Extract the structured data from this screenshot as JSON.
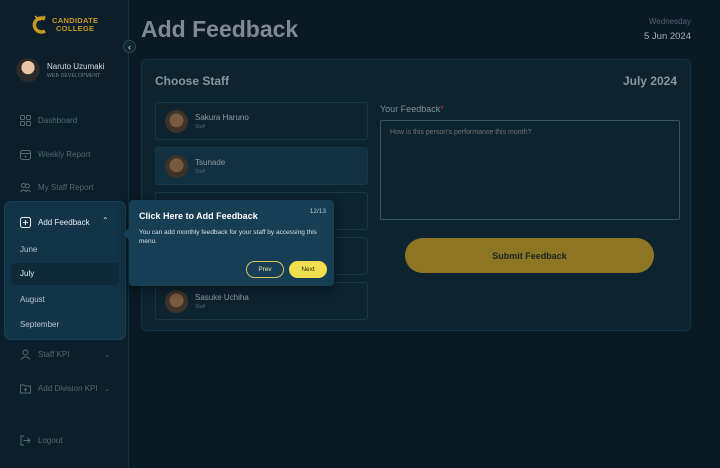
{
  "brand": {
    "name_line1": "CANDIDATE",
    "name_line2": "COLLEGE"
  },
  "profile": {
    "name": "Naruto Uzumaki",
    "role": "WEB DEVELOPMENT"
  },
  "sidebar": {
    "items": [
      {
        "label": "Dashboard",
        "icon": "grid-icon"
      },
      {
        "label": "Weekly Report",
        "icon": "calendar-icon"
      },
      {
        "label": "My Staff Report",
        "icon": "users-icon"
      },
      {
        "label": "Add Feedback",
        "icon": "plus-square-icon",
        "expanded": true
      },
      {
        "label": "Staff KPI",
        "icon": "user-icon"
      },
      {
        "label": "Add Division KPI",
        "icon": "folder-plus-icon"
      }
    ],
    "submenu": [
      "June",
      "July",
      "August",
      "September"
    ],
    "submenu_active": "July",
    "logout": "Logout"
  },
  "header": {
    "title": "Add Feedback",
    "day": "Wednesday",
    "date": "5 Jun 2024"
  },
  "card": {
    "title": "Choose Staff",
    "month": "July 2024",
    "staff": [
      {
        "name": "Sakura Haruno",
        "role": "Staff"
      },
      {
        "name": "Tsunade",
        "role": "Staff",
        "selected": true
      },
      {
        "name": "",
        "role": ""
      },
      {
        "name": "",
        "role": ""
      },
      {
        "name": "Sasuke Uchiha",
        "role": "Staff"
      }
    ],
    "feedback_label": "Your Feedback",
    "feedback_required": "*",
    "feedback_placeholder": "How is this person's performance this month?",
    "submit_label": "Submit Feedback"
  },
  "tour": {
    "title": "Click Here to Add Feedback",
    "count": "12/13",
    "body": "You can add monthly feedback for your staff by accessing this menu.",
    "prev": "Prev",
    "next": "Next"
  },
  "colors": {
    "accent": "#8d7623",
    "tour_bg": "#163e55",
    "next_btn": "#f2df4f",
    "brand": "#c79a22"
  }
}
